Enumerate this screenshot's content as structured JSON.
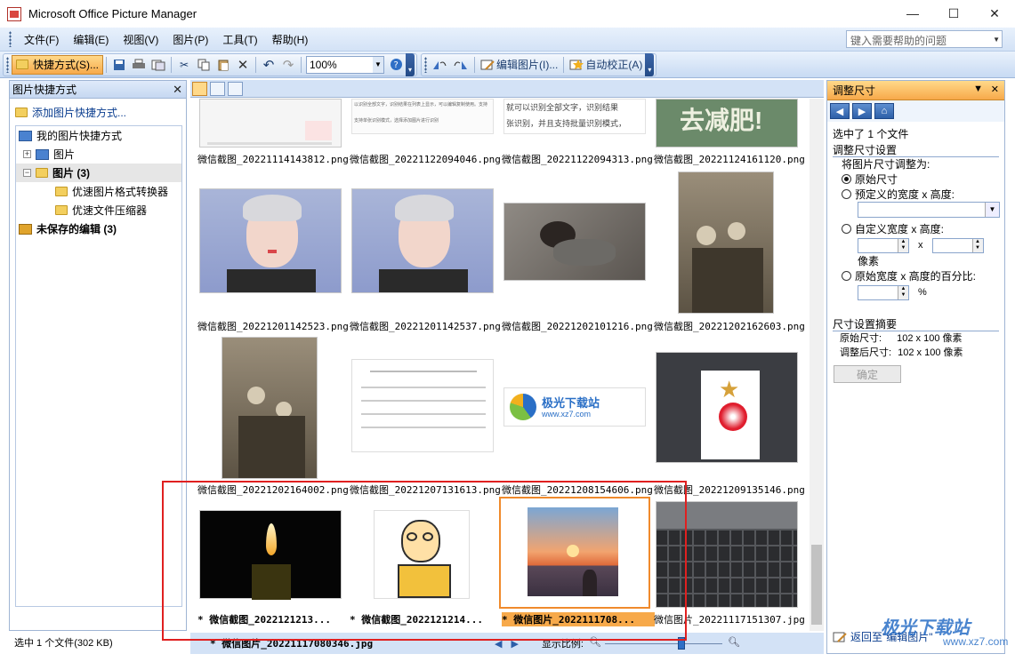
{
  "window": {
    "title": "Microsoft Office Picture Manager",
    "min": "—",
    "max": "☐",
    "close": "✕"
  },
  "menu": {
    "items": [
      "文件(F)",
      "编辑(E)",
      "视图(V)",
      "图片(P)",
      "工具(T)",
      "帮助(H)"
    ],
    "help_placeholder": "键入需要帮助的问题"
  },
  "toolbar": {
    "shortcuts": "快捷方式(S)...",
    "zoom": "100%",
    "edit_pictures": "编辑图片(I)...",
    "auto_correct": "自动校正(A)"
  },
  "left_pane": {
    "title": "图片快捷方式",
    "add_link": "添加图片快捷方式...",
    "tree": {
      "root": "我的图片快捷方式",
      "item1": "图片",
      "item2": "图片 (3)",
      "child1": "优速图片格式转换器",
      "child2": "优速文件压缩器",
      "unsaved": "未保存的编辑 (3)"
    },
    "status": "选中 1 个文件(302 KB)"
  },
  "grid": {
    "row1": [
      "微信截图_20221114143812.png",
      "微信截图_20221122094046.png",
      "微信截图_20221122094313.png",
      "微信截图_20221124161120.png"
    ],
    "row2": [
      "微信截图_20221201142523.png",
      "微信截图_20221201142537.png",
      "微信截图_20221202101216.png",
      "微信截图_20221202162603.png"
    ],
    "row3": [
      "微信截图_20221202164002.png",
      "微信截图_20221207131613.png",
      "微信截图_20221208154606.png",
      "微信截图_20221209135146.png"
    ],
    "row4": [
      "* 微信截图_2022121213...",
      "* 微信截图_2022121214...",
      "* 微信图片_2022111708...",
      "微信图片_20221117151307.jpg"
    ],
    "thumb_texts": {
      "slogan": "去减肥!",
      "doc_line1": "以识别全部文字，识别结果在列表上显示，可以编辑复制使用。支持",
      "doc_line2": "支持单张识别模式，选择添加图片进行识别",
      "ocr_line1": "就可以识别全部文字，识别结果",
      "ocr_line2": "张识别，并且支持批量识别模式，",
      "logo_name": "极光下载站",
      "logo_url": "www.xz7.com"
    }
  },
  "bottom_bar": {
    "file": "* 微信图片_20221117080346.jpg",
    "ratio_label": "显示比例:",
    "zoom_fraction": 0.65
  },
  "right_pane": {
    "title": "调整尺寸",
    "selected": "选中了 1 个文件",
    "settings_title": "调整尺寸设置",
    "adjust_to": "将图片尺寸调整为:",
    "opt_original": "原始尺寸",
    "opt_predefined": "预定义的宽度 x 高度:",
    "opt_custom": "自定义宽度 x 高度:",
    "x": "x",
    "pixels": "像素",
    "opt_percent": "原始宽度 x 高度的百分比:",
    "percent": "%",
    "summary_title": "尺寸设置摘要",
    "orig_size_label": "原始尺寸:",
    "orig_size_value": "102 x 100 像素",
    "new_size_label": "调整后尺寸:",
    "new_size_value": "102 x 100 像素",
    "confirm": "确定",
    "back_link": "返回至\"编辑图片\""
  },
  "watermark": {
    "text": "极光下载站",
    "url": "www.xz7.com"
  },
  "colors": {
    "accent": "#f7a94a",
    "highlight_box": "#e02020",
    "ribbon": "#d3e2f6"
  }
}
